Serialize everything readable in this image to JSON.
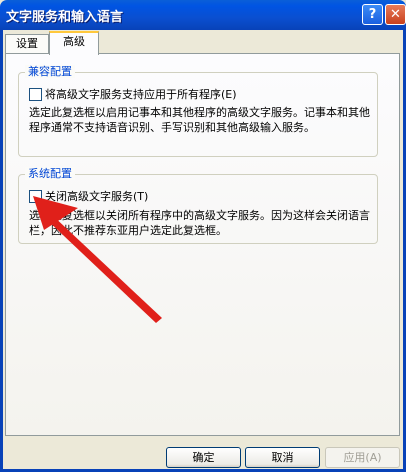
{
  "window": {
    "title": "文字服务和输入语言",
    "help_glyph": "?",
    "close_glyph": "✕"
  },
  "tabs": [
    {
      "label": "设置"
    },
    {
      "label": "高级"
    }
  ],
  "compat_group": {
    "title": "兼容配置",
    "checkbox_label": "将高级文字服务支持应用于所有程序(E)",
    "description": "选定此复选框以启用记事本和其他程序的高级文字服务。记事本和其他程序通常不支持语音识别、手写识别和其他高级输入服务。"
  },
  "system_group": {
    "title": "系统配置",
    "checkbox_label": "关闭高级文字服务(T)",
    "description": "选定此复选框以关闭所有程序中的高级文字服务。因为这样会关闭语言栏，因此不推荐东亚用户选定此复选框。"
  },
  "buttons": {
    "ok": "确定",
    "cancel": "取消",
    "apply": "应用(A)"
  },
  "colors": {
    "titlebar": "#0054e3",
    "annotation_arrow": "#e0201a",
    "group_title": "#0046d5"
  }
}
